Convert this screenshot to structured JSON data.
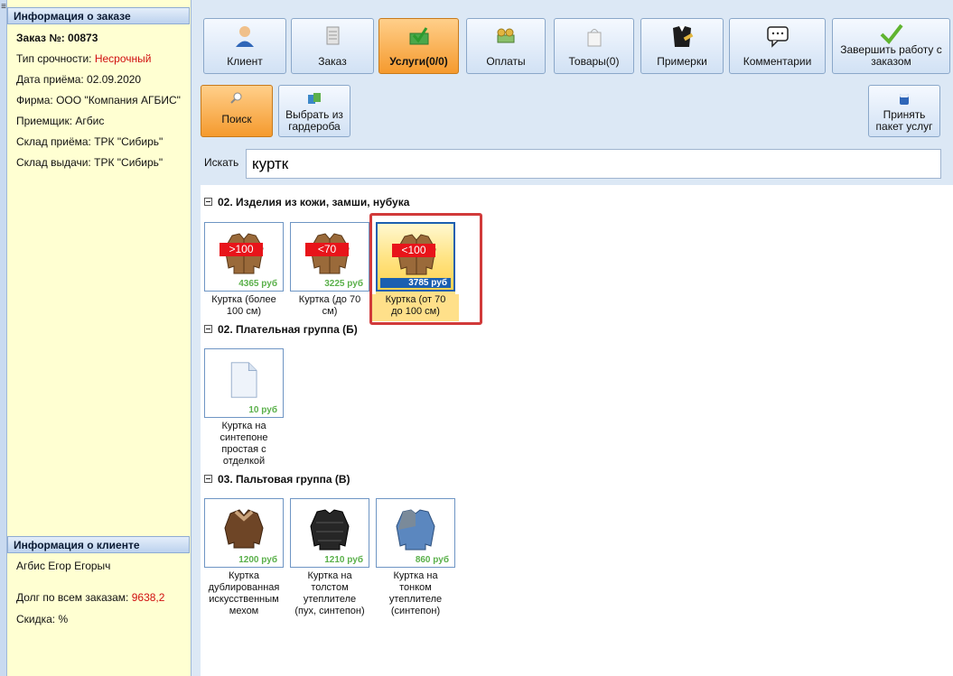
{
  "order_info": {
    "title": "Информация о заказе",
    "order_no_label": "Заказ №: ",
    "order_no": "00873",
    "urgency_label": "Тип срочности: ",
    "urgency": "Несрочный",
    "date_label": "Дата приёма: ",
    "date": "02.09.2020",
    "firm_label": "Фирма: ",
    "firm": "ООО \"Компания АГБИС\"",
    "receiver_label": "Приемщик: ",
    "receiver": "Агбис",
    "warehouse_in_label": "Склад приёма: ",
    "warehouse_in": "ТРК \"Сибирь\"",
    "warehouse_out_label": "Склад выдачи: ",
    "warehouse_out": "ТРК \"Сибирь\""
  },
  "client_info": {
    "title": "Информация о клиенте",
    "name": "Агбис Егор Егорыч",
    "debt_label": "Долг по всем заказам: ",
    "debt": "9638,2",
    "discount_label": "Скидка: ",
    "discount": "%"
  },
  "toolbar": {
    "client": "Клиент",
    "order": "Заказ",
    "services": "Услуги(0/0)",
    "payments": "Оплаты",
    "goods": "Товары(0)",
    "fittings": "Примерки",
    "comments": "Комментарии",
    "finish_line1": "Завершить работу с",
    "finish_line2": "заказом"
  },
  "subtoolbar": {
    "search": "Поиск",
    "wardrobe_line1": "Выбрать из",
    "wardrobe_line2": "гардероба",
    "accept_line1": "Принять",
    "accept_line2": "пакет услуг"
  },
  "search": {
    "label": "Искать",
    "value": "куртк"
  },
  "groups": [
    {
      "title": "02. Изделия из кожи, замши, нубука",
      "items": [
        {
          "tag": ">100",
          "price": "4365 руб",
          "caption1": "Куртка (более",
          "caption2": "100 см)"
        },
        {
          "tag": "<70",
          "price": "3225 руб",
          "caption1": "Куртка (до 70",
          "caption2": "см)"
        },
        {
          "tag": "<100",
          "price": "3785 руб",
          "caption1": "Куртка (от 70",
          "caption2": "до 100 см)"
        }
      ]
    },
    {
      "title": "02. Плательная группа (Б)",
      "items": [
        {
          "price": "10 руб",
          "caption1": "Куртка на",
          "caption2": "синтепоне",
          "caption3": "простая с",
          "caption4": "отделкой"
        }
      ]
    },
    {
      "title": "03. Пальтовая группа (В)",
      "items": [
        {
          "price": "1200 руб",
          "caption1": "Куртка",
          "caption2": "дублированная",
          "caption3": "искусственным",
          "caption4": "мехом"
        },
        {
          "price": "1210 руб",
          "caption1": "Куртка на",
          "caption2": "толстом",
          "caption3": "утеплителе",
          "caption4": "(пух, синтепон)"
        },
        {
          "price": "860 руб",
          "caption1": "Куртка на",
          "caption2": "тонком",
          "caption3": "утеплителе",
          "caption4": "(синтепон)"
        }
      ]
    }
  ],
  "colors": {
    "accent_orange": "#f59a2e",
    "panel_yellow": "#ffffd2",
    "price_green": "#5ab04a",
    "tag_red": "#e8141a",
    "highlight_red": "#d13a3a"
  }
}
